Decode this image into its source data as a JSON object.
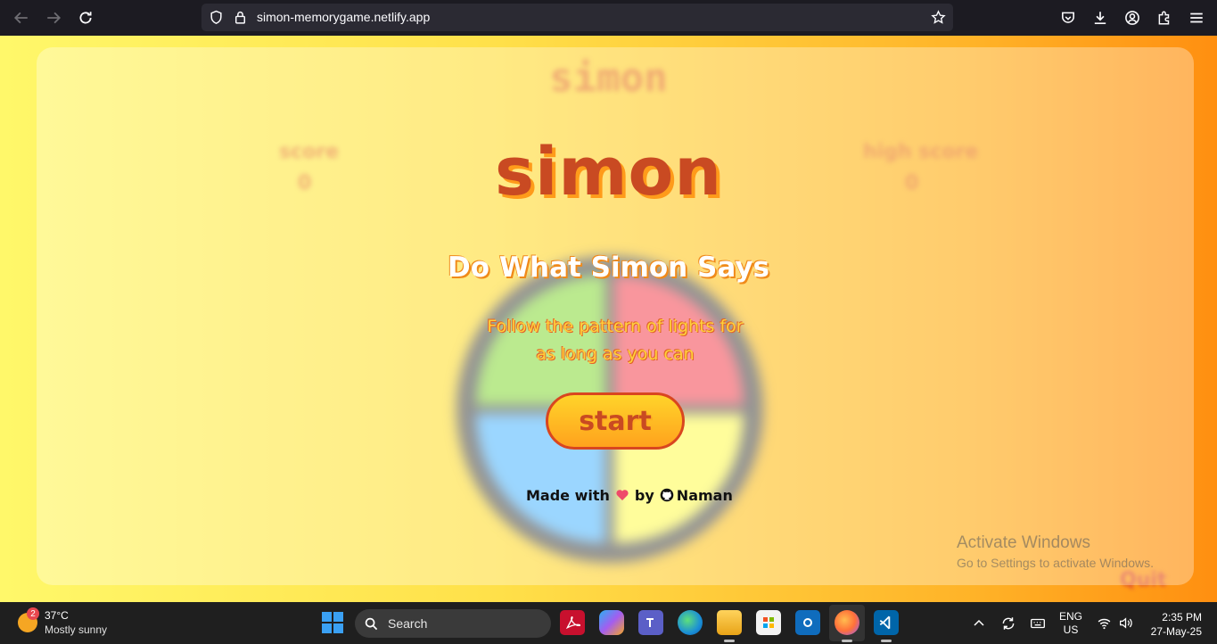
{
  "browser": {
    "url": "simon-memorygame.netlify.app"
  },
  "background_game": {
    "title": "simon",
    "score_label": "score",
    "score_value": "0",
    "high_score_label": "high score",
    "high_score_value": "0",
    "quit_label": "Quit"
  },
  "modal": {
    "title": "simon",
    "subtitle": "Do What Simon Says",
    "description_line1": "Follow the pattern of lights for",
    "description_line2": "as long as you can",
    "start_label": "start",
    "credit_prefix": "Made with",
    "credit_by": "by",
    "credit_author": "Naman"
  },
  "watermark": {
    "line1": "Activate Windows",
    "line2": "Go to Settings to activate Windows."
  },
  "taskbar": {
    "weather_temp": "37°C",
    "weather_condition": "Mostly sunny",
    "weather_badge": "2",
    "search_placeholder": "Search",
    "lang_line1": "ENG",
    "lang_line2": "US",
    "time": "2:35 PM",
    "date": "27-May-25"
  },
  "colors": {
    "accent_orange": "#ff9b1a",
    "title_red": "#c94a22",
    "board_green": "#9be05a",
    "board_red": "#f7656f",
    "board_blue": "#6cc3ff",
    "board_yellow": "#fffc6c"
  }
}
